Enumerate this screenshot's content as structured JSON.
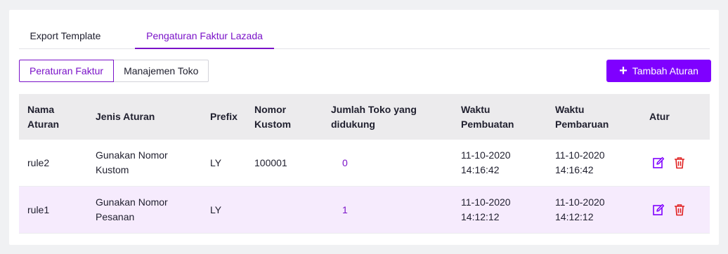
{
  "tabs": [
    {
      "label": "Export Template"
    },
    {
      "label": "Pengaturan Faktur Lazada"
    }
  ],
  "subtabs": [
    {
      "label": "Peraturan Faktur"
    },
    {
      "label": "Manajemen Toko"
    }
  ],
  "add_button": {
    "label": "Tambah Aturan"
  },
  "columns": [
    {
      "line1": "Nama",
      "line2": "Aturan"
    },
    {
      "line1": "Jenis Aturan",
      "line2": ""
    },
    {
      "line1": "Prefix",
      "line2": ""
    },
    {
      "line1": "Nomor",
      "line2": "Kustom"
    },
    {
      "line1": "Jumlah Toko yang",
      "line2": "didukung"
    },
    {
      "line1": "Waktu",
      "line2": "Pembuatan"
    },
    {
      "line1": "Waktu",
      "line2": "Pembaruan"
    },
    {
      "line1": "Atur",
      "line2": ""
    }
  ],
  "rows": [
    {
      "name": "rule2",
      "type1": "Gunakan Nomor",
      "type2": "Kustom",
      "prefix": "LY",
      "custom": "100001",
      "count": "0",
      "created_date": "11-10-2020",
      "created_time": "14:16:42",
      "updated_date": "11-10-2020",
      "updated_time": "14:16:42"
    },
    {
      "name": "rule1",
      "type1": "Gunakan Nomor",
      "type2": "Pesanan",
      "prefix": "LY",
      "custom": "",
      "count": "1",
      "created_date": "11-10-2020",
      "created_time": "14:12:12",
      "updated_date": "11-10-2020",
      "updated_time": "14:12:12"
    }
  ],
  "colors": {
    "accent": "#7f00ff",
    "delete": "#e02020",
    "row_highlight": "#f6ebfd"
  },
  "icons": {
    "edit": "edit-icon",
    "delete": "trash-icon",
    "add": "plus-icon"
  }
}
